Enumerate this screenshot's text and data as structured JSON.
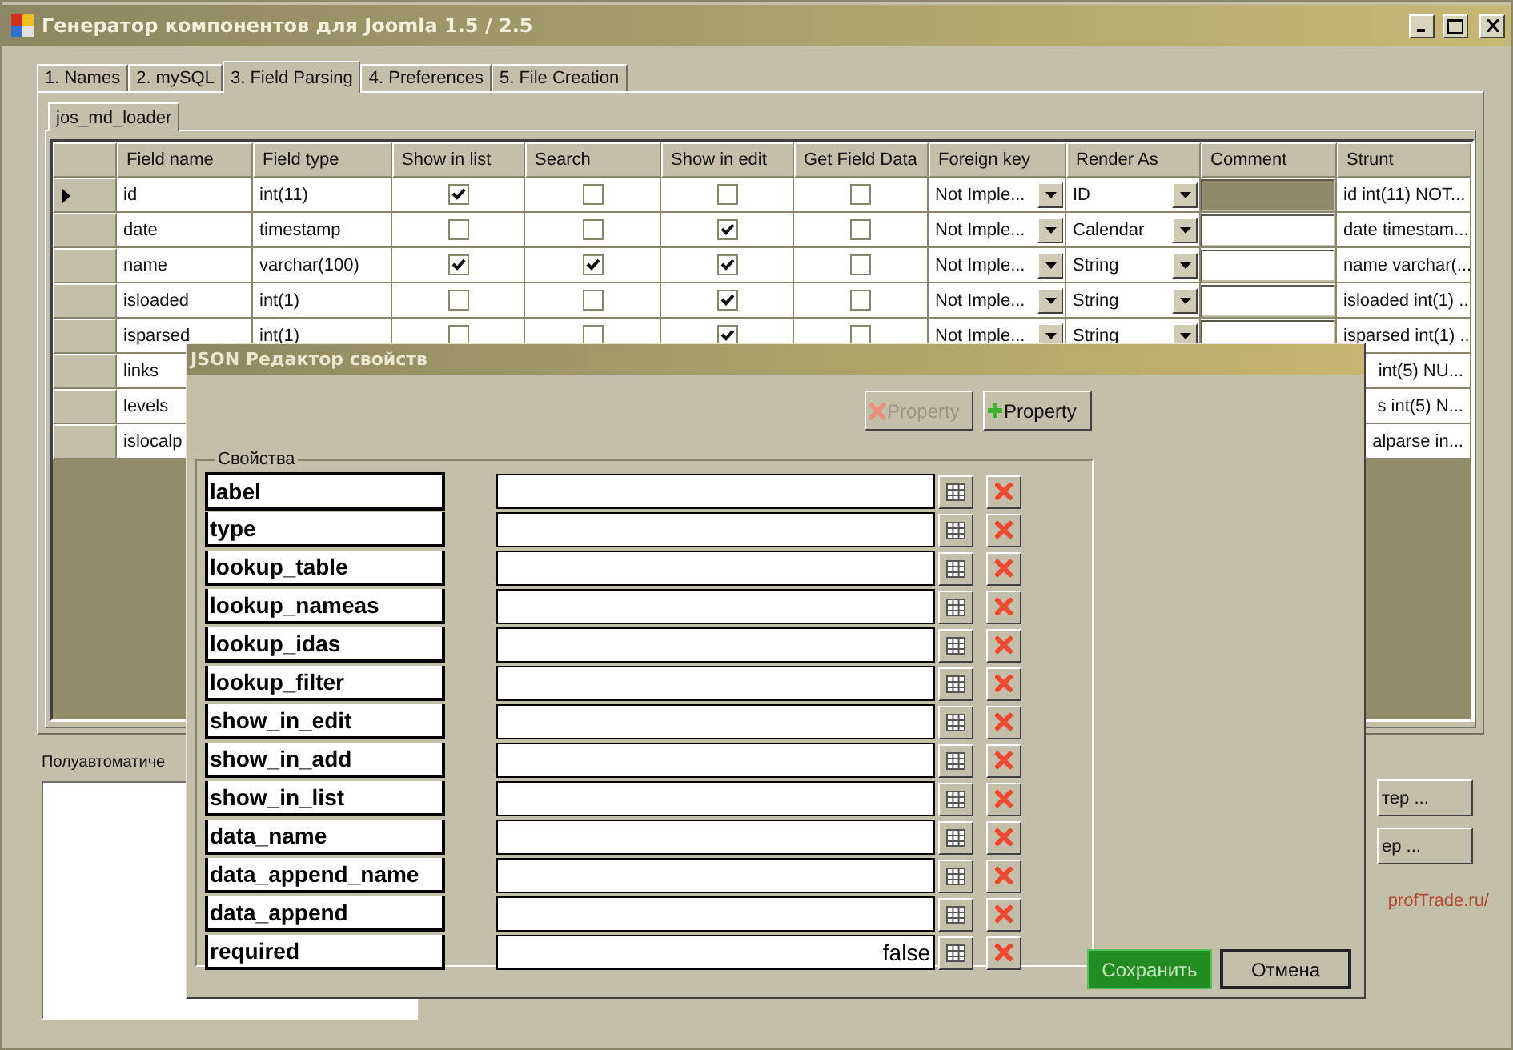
{
  "window": {
    "title": "Генератор компонентов для Joomla 1.5 / 2.5"
  },
  "tabs": [
    {
      "label": "1. Names",
      "selected": false
    },
    {
      "label": "2. mySQL",
      "selected": false
    },
    {
      "label": "3. Field Parsing",
      "selected": true
    },
    {
      "label": "4. Preferences",
      "selected": false
    },
    {
      "label": "5. File Creation",
      "selected": false
    }
  ],
  "subtabs": [
    {
      "label": "jos_md_loader",
      "selected": true
    }
  ],
  "table": {
    "columns": [
      "Field name",
      "Field type",
      "Show in list",
      "Search",
      "Show in edit",
      "Get Field Data",
      "Foreign key",
      "Render As",
      "Comment",
      "Strunt"
    ],
    "rows": [
      {
        "kind": "full",
        "current": true,
        "field_name": "id",
        "field_type": "int(11)",
        "show_in_list": true,
        "search": false,
        "show_in_edit": false,
        "get_field_data": false,
        "foreign_key": "Not Imple...",
        "render_as": "ID",
        "comment_selected": true,
        "strunt": "id int(11) NOT..."
      },
      {
        "kind": "full",
        "current": false,
        "field_name": "date",
        "field_type": "timestamp",
        "show_in_list": false,
        "search": false,
        "show_in_edit": true,
        "get_field_data": false,
        "foreign_key": "Not Imple...",
        "render_as": "Calendar",
        "comment_selected": false,
        "strunt": "date timestam..."
      },
      {
        "kind": "full",
        "current": false,
        "field_name": "name",
        "field_type": "varchar(100)",
        "show_in_list": true,
        "search": true,
        "show_in_edit": true,
        "get_field_data": false,
        "foreign_key": "Not Imple...",
        "render_as": "String",
        "comment_selected": false,
        "strunt": "name varchar(..."
      },
      {
        "kind": "full",
        "current": false,
        "field_name": "isloaded",
        "field_type": "int(1)",
        "show_in_list": false,
        "search": false,
        "show_in_edit": true,
        "get_field_data": false,
        "foreign_key": "Not Imple...",
        "render_as": "String",
        "comment_selected": false,
        "strunt": "isloaded int(1) ..."
      },
      {
        "kind": "full",
        "current": false,
        "field_name": "isparsed",
        "field_type": "int(1)",
        "show_in_list": false,
        "search": false,
        "show_in_edit": true,
        "get_field_data": false,
        "foreign_key": "Not Imple...",
        "render_as": "String",
        "comment_selected": false,
        "strunt": "isparsed int(1) ..."
      },
      {
        "kind": "covered",
        "current": false,
        "field_name": "links",
        "strunt": "int(5) NU..."
      },
      {
        "kind": "covered",
        "current": false,
        "field_name": "levels",
        "strunt": "s int(5) N..."
      },
      {
        "kind": "covered",
        "current": false,
        "field_name": "islocalp",
        "strunt": "alparse in..."
      }
    ]
  },
  "bottom": {
    "label": "Полуавтоматиче",
    "buttons": [
      "тер ...",
      "ер ..."
    ],
    "link": "profTrade.ru/"
  },
  "dialog": {
    "title": "JSON Редактор свойств",
    "buttons": [
      {
        "kind": "remove",
        "label": "Property",
        "disabled": true
      },
      {
        "kind": "add",
        "label": "Property",
        "disabled": false
      }
    ],
    "group_title": "Свойства",
    "properties": [
      {
        "name": "label"
      },
      {
        "name": "type"
      },
      {
        "name": "lookup_table"
      },
      {
        "name": "lookup_nameas"
      },
      {
        "name": "lookup_idas"
      },
      {
        "name": "lookup_filter"
      },
      {
        "name": "show_in_edit"
      },
      {
        "name": "show_in_add"
      },
      {
        "name": "show_in_list"
      },
      {
        "name": "data_name"
      },
      {
        "name": "data_append_name"
      },
      {
        "name": "data_append"
      },
      {
        "name": "required",
        "value": "false"
      }
    ],
    "actions": [
      {
        "kind": "primary",
        "label": "Сохранить"
      },
      {
        "kind": "normal",
        "label": "Отмена"
      }
    ]
  }
}
